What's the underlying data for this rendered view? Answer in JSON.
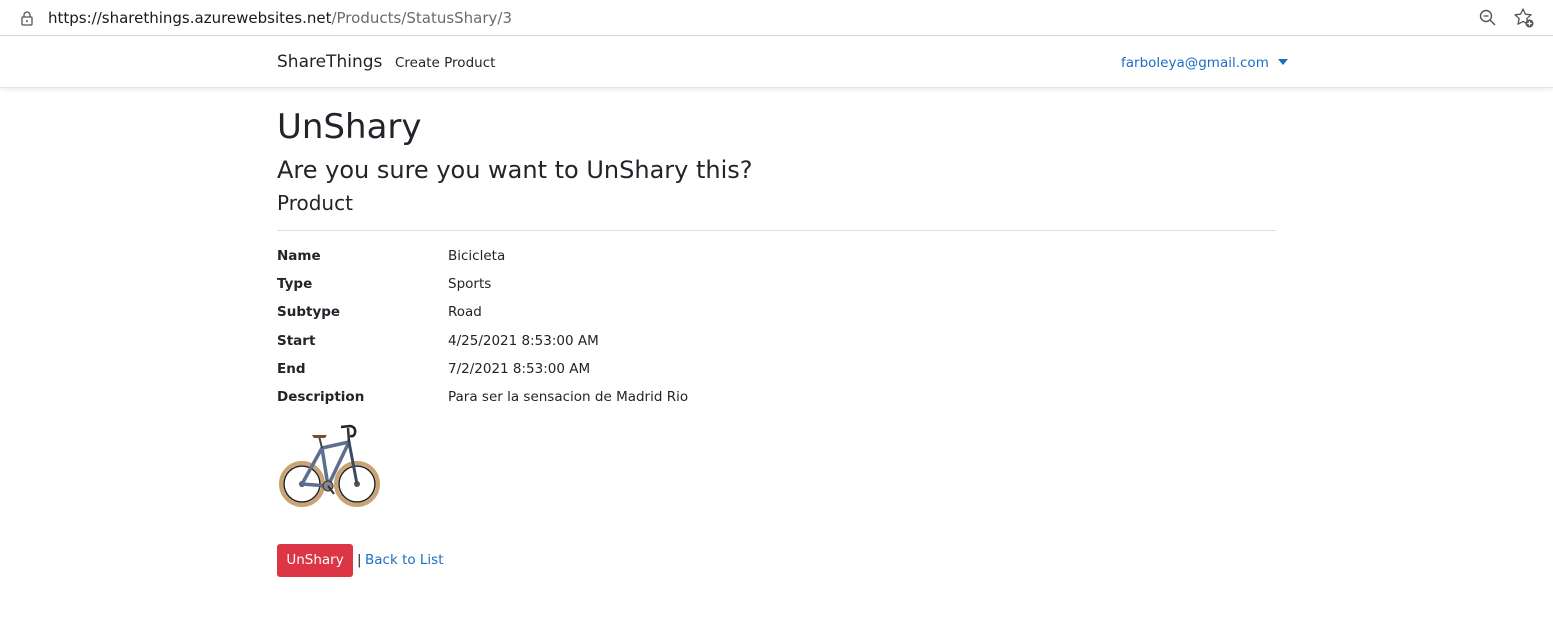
{
  "browser": {
    "url_host": "https://sharethings.azurewebsites.net",
    "url_path": "/Products/StatusShary/3",
    "icons": [
      "lock-icon",
      "zoom-icon",
      "favorite-icon"
    ]
  },
  "navbar": {
    "brand": "ShareThings",
    "links": [
      "Create Product"
    ],
    "user": "farboleya@gmail.com"
  },
  "page": {
    "title": "UnShary",
    "question": "Are you sure you want to UnShary this?",
    "section": "Product"
  },
  "details": [
    {
      "label": "Name",
      "value": "Bicicleta"
    },
    {
      "label": "Type",
      "value": "Sports"
    },
    {
      "label": "Subtype",
      "value": "Road"
    },
    {
      "label": "Start",
      "value": "4/25/2021 8:53:00 AM"
    },
    {
      "label": "End",
      "value": "7/2/2021 8:53:00 AM"
    },
    {
      "label": "Description",
      "value": "Para ser la sensacion de Madrid Rio"
    }
  ],
  "actions": {
    "submit": "UnShary",
    "separator": "|",
    "back": "Back to List"
  },
  "colors": {
    "danger": "#dc3545",
    "link": "#1a6fc4",
    "text": "#212529"
  }
}
